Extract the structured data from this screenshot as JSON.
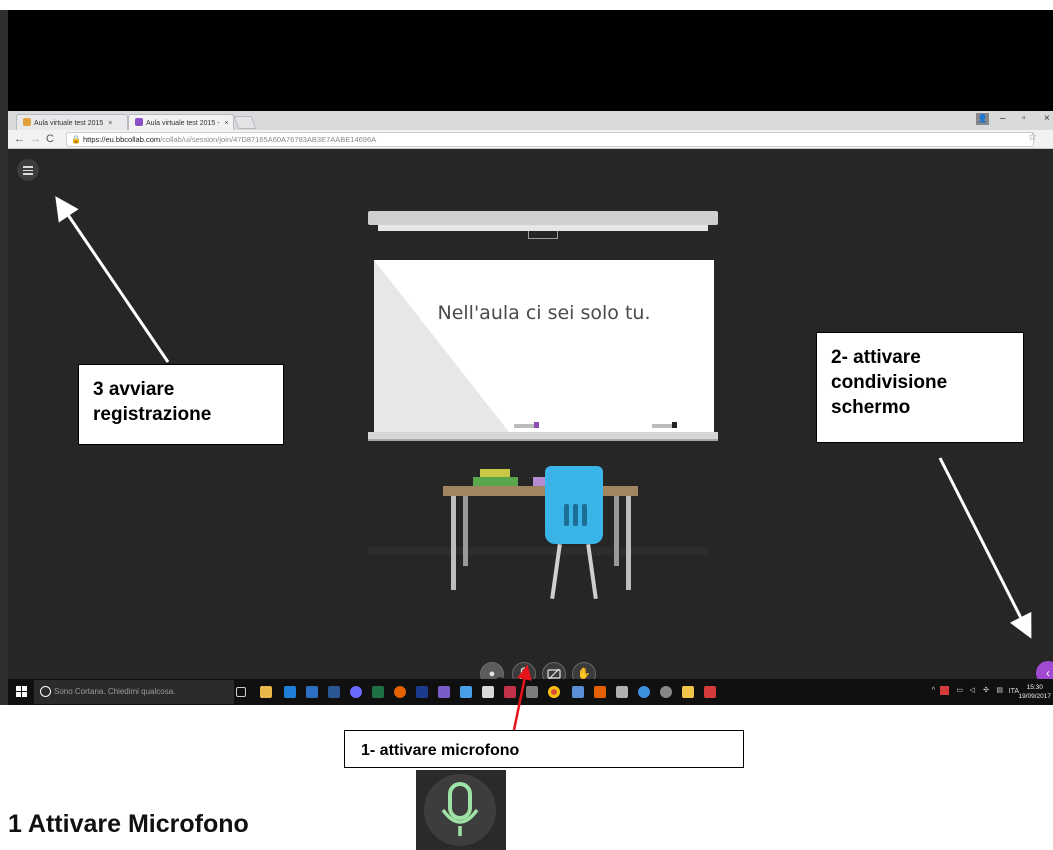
{
  "browser": {
    "tabs": [
      {
        "label": "Aula virtuale test 2015",
        "close": "×"
      },
      {
        "label": "Aula virtuale test 2015 -",
        "close": "×"
      }
    ],
    "window_controls": {
      "minimize": "–",
      "maximize": "▫",
      "close": "×"
    },
    "address": {
      "host": "https://eu.bbcollab.com",
      "path": "/collab/ui/session/join/47D87165A60A76783AB3E7AABE14696A"
    }
  },
  "classroom": {
    "board_message": "Nell'aula ci sei solo tu."
  },
  "controls": {
    "microphone_icon": "mic-off-icon",
    "camera_icon": "camera-off-icon",
    "hand_icon": "raise-hand-icon",
    "collab_panel_icon": "collab-panel-icon"
  },
  "taskbar": {
    "cortana_placeholder": "Sono Cortana. Chiedimi qualcosa.",
    "language": "ITA",
    "time": "15:30",
    "date": "19/09/2017"
  },
  "annotations": {
    "step1": "1-  attivare microfono",
    "step2_line1": "2- attivare",
    "step2_line2": "condivisione",
    "step2_line3": "schermo",
    "step3_line1": "3 avviare",
    "step3_line2": "registrazione"
  },
  "heading": "1 Attivare Microfono",
  "colors": {
    "app_background": "#262626",
    "collab_accent": "#a04ad3",
    "presence_green": "#36b24a",
    "chair_blue": "#3ab4e6",
    "annotation_arrow_red": "#e8141c"
  }
}
